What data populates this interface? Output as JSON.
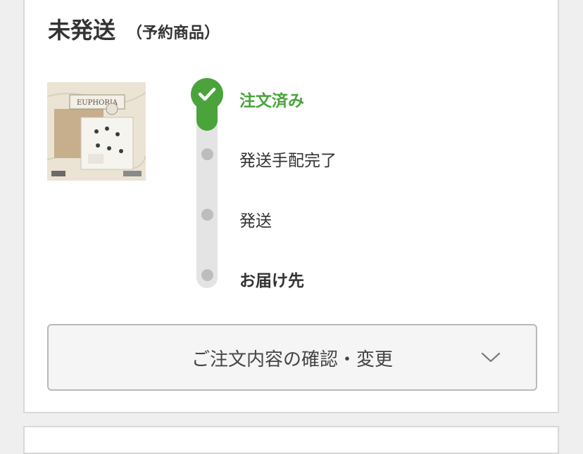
{
  "header": {
    "status_title": "未発送",
    "status_subtitle": "（予約商品）"
  },
  "product": {
    "thumbnail_text": "EUPHORIA"
  },
  "progress": {
    "steps": [
      {
        "label": "注文済み",
        "state": "done"
      },
      {
        "label": "発送手配完了",
        "state": "pending"
      },
      {
        "label": "発送",
        "state": "pending"
      },
      {
        "label": "お届け先",
        "state": "pending"
      }
    ],
    "completed_count": 1,
    "accent_color": "#4aa33b",
    "inactive_color": "#bdbdbd"
  },
  "accordion": {
    "label": "ご注文内容の確認・変更",
    "icon": "chevron-down-icon"
  }
}
